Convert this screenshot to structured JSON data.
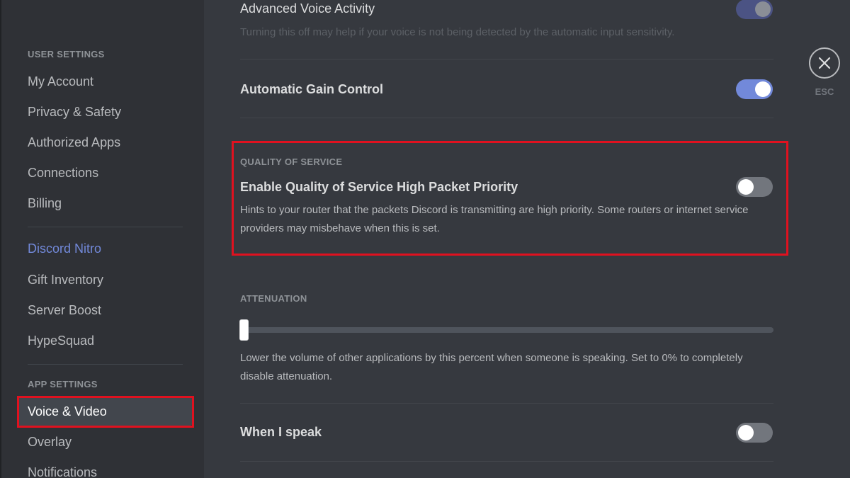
{
  "sidebar": {
    "user_settings_header": "USER SETTINGS",
    "user_items": [
      "My Account",
      "Privacy & Safety",
      "Authorized Apps",
      "Connections",
      "Billing"
    ],
    "nitro_items": [
      "Discord Nitro",
      "Gift Inventory",
      "Server Boost",
      "HypeSquad"
    ],
    "app_settings_header": "APP SETTINGS",
    "app_items": [
      "Voice & Video",
      "Overlay",
      "Notifications"
    ],
    "selected_item": "Voice & Video"
  },
  "main": {
    "advanced_voice": {
      "title": "Advanced Voice Activity",
      "description": "Turning this off may help if your voice is not being detected by the automatic input sensitivity.",
      "enabled": true
    },
    "agc": {
      "title": "Automatic Gain Control",
      "enabled": true
    },
    "qos": {
      "section_label": "QUALITY OF SERVICE",
      "title": "Enable Quality of Service High Packet Priority",
      "description": "Hints to your router that the packets Discord is transmitting are high priority. Some routers or internet service providers may misbehave when this is set.",
      "enabled": false
    },
    "attenuation": {
      "section_label": "ATTENUATION",
      "value_percent": 0,
      "description": "Lower the volume of other applications by this percent when someone is speaking. Set to 0% to completely disable attenuation."
    },
    "when_i_speak": {
      "title": "When I speak",
      "enabled": false
    }
  },
  "close": {
    "label": "ESC"
  },
  "colors": {
    "accent": "#7289da",
    "highlight": "#e0111f",
    "background": "#36393f",
    "sidebar": "#2f3136"
  }
}
